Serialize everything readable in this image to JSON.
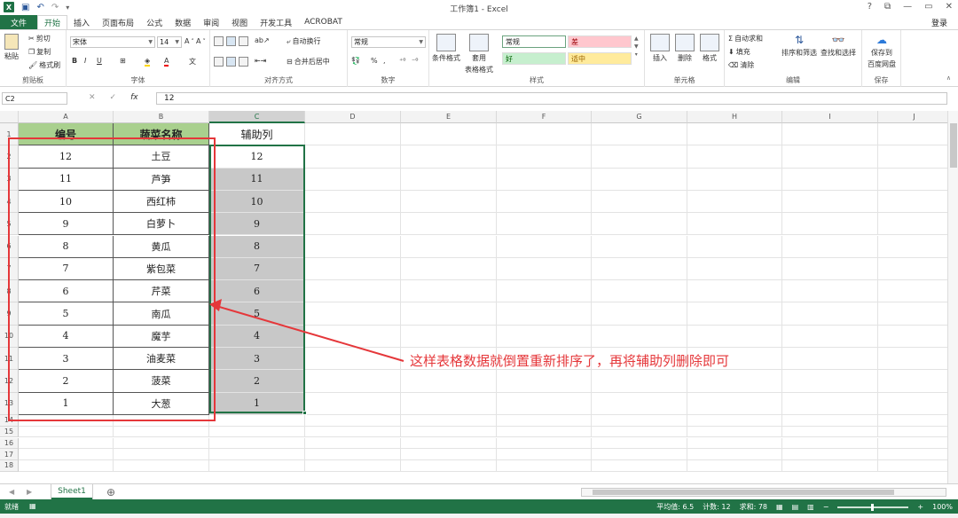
{
  "window": {
    "title": "工作簿1 - Excel",
    "help": "?",
    "restore": "⧉",
    "minimize": "—",
    "maximize": "🗗",
    "close": "✕",
    "login": "登录"
  },
  "tabs": [
    "文件",
    "开始",
    "插入",
    "页面布局",
    "公式",
    "数据",
    "审阅",
    "视图",
    "开发工具",
    "ACROBAT"
  ],
  "ribbon": {
    "clipboard": {
      "paste": "粘贴",
      "cut": "剪切",
      "copy": "复制",
      "format_painter": "格式刷",
      "label": "剪贴板"
    },
    "font": {
      "name": "宋体",
      "size": "14",
      "bold": "B",
      "italic": "I",
      "underline": "U",
      "label": "字体"
    },
    "alignment": {
      "wrap": "自动换行",
      "merge": "合并后居中",
      "label": "对齐方式"
    },
    "number": {
      "format": "常规",
      "percent": "%",
      "comma": ",",
      "label": "数字"
    },
    "styles": {
      "conditional": "条件格式",
      "table": "套用",
      "table2": "表格格式",
      "normal": "常规",
      "bad": "差",
      "good": "好",
      "neutral": "适中",
      "label": "样式"
    },
    "cells": {
      "insert": "插入",
      "delete": "删除",
      "format": "格式",
      "label": "单元格"
    },
    "editing": {
      "autosum": "自动求和",
      "fill": "填充",
      "clear": "清除",
      "sort": "排序和筛选",
      "find": "查找和选择",
      "label": "编辑"
    },
    "save": {
      "line1": "保存到",
      "line2": "百度网盘",
      "label": "保存"
    }
  },
  "formula_bar": {
    "name_box": "C2",
    "fx": "fx",
    "value": "12"
  },
  "columns": [
    "A",
    "B",
    "C",
    "D",
    "E",
    "F",
    "G",
    "H",
    "I",
    "J"
  ],
  "rows": [
    "1",
    "2",
    "3",
    "4",
    "5",
    "6",
    "7",
    "8",
    "9",
    "10",
    "11",
    "12",
    "13",
    "14",
    "15",
    "16",
    "17",
    "18"
  ],
  "table": {
    "headers": [
      "编号",
      "蔬菜名称",
      "辅助列"
    ],
    "rows": [
      [
        "12",
        "土豆",
        "12"
      ],
      [
        "11",
        "芦笋",
        "11"
      ],
      [
        "10",
        "西红柿",
        "10"
      ],
      [
        "9",
        "白萝卜",
        "9"
      ],
      [
        "8",
        "黄瓜",
        "8"
      ],
      [
        "7",
        "紫包菜",
        "7"
      ],
      [
        "6",
        "芹菜",
        "6"
      ],
      [
        "5",
        "南瓜",
        "5"
      ],
      [
        "4",
        "魔芋",
        "4"
      ],
      [
        "3",
        "油麦菜",
        "3"
      ],
      [
        "2",
        "菠菜",
        "2"
      ],
      [
        "1",
        "大葱",
        "1"
      ]
    ]
  },
  "annotation": "这样表格数据就倒置重新排序了，再将辅助列删除即可",
  "sheet": {
    "tab": "Sheet1",
    "add": "⊕"
  },
  "status": {
    "mode": "就绪",
    "average": "平均值: 6.5",
    "count": "计数: 12",
    "sum": "求和: 78",
    "zoom": "100%"
  },
  "colors": {
    "accent": "#217346",
    "header_fill": "#a9d08e",
    "annotation": "#e5373a",
    "selected_fill": "#c8c8c8"
  }
}
